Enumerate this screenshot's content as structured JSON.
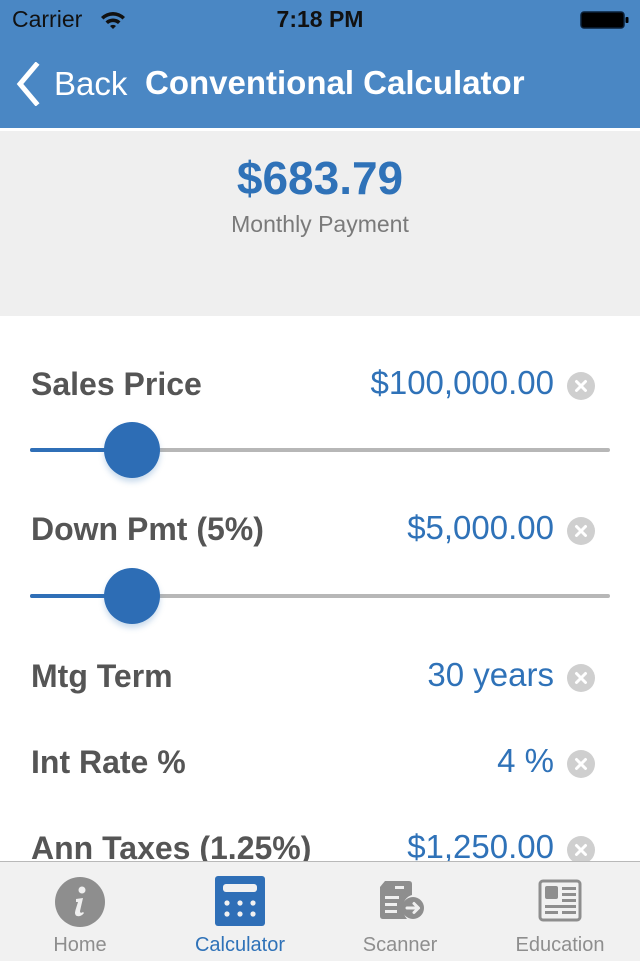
{
  "status_bar": {
    "carrier": "Carrier",
    "time": "7:18 PM",
    "wifi_icon": "wifi-icon",
    "battery_icon": "battery-icon"
  },
  "nav": {
    "back_label": "Back",
    "back_icon": "chevron-left-icon",
    "title": "Conventional Calculator"
  },
  "summary": {
    "amount": "$683.79",
    "label": "Monthly Payment"
  },
  "fields": [
    {
      "label": "Sales Price",
      "value": "$100,000.00",
      "clear_icon": "clear-icon",
      "slider": {
        "fraction": 0.175
      }
    },
    {
      "label": "Down Pmt (5%)",
      "value": "$5,000.00",
      "clear_icon": "clear-icon",
      "slider": {
        "fraction": 0.175
      }
    },
    {
      "label": "Mtg Term",
      "value": "30 years",
      "clear_icon": "clear-icon"
    },
    {
      "label": "Int Rate %",
      "value": "4 %",
      "clear_icon": "clear-icon"
    },
    {
      "label": "Ann Taxes (1.25%)",
      "value": "$1,250.00",
      "clear_icon": "clear-icon"
    }
  ],
  "tabs": [
    {
      "label": "Home",
      "icon": "info-icon",
      "active": false
    },
    {
      "label": "Calculator",
      "icon": "calculator-icon",
      "active": true
    },
    {
      "label": "Scanner",
      "icon": "document-scan-icon",
      "active": false
    },
    {
      "label": "Education",
      "icon": "newspaper-icon",
      "active": false
    }
  ],
  "colors": {
    "nav_background": "#4a87c4",
    "accent": "#2f72b8",
    "summary_background": "#efefef",
    "label_text": "#555555",
    "inactive_tab": "#8e8e8e"
  }
}
